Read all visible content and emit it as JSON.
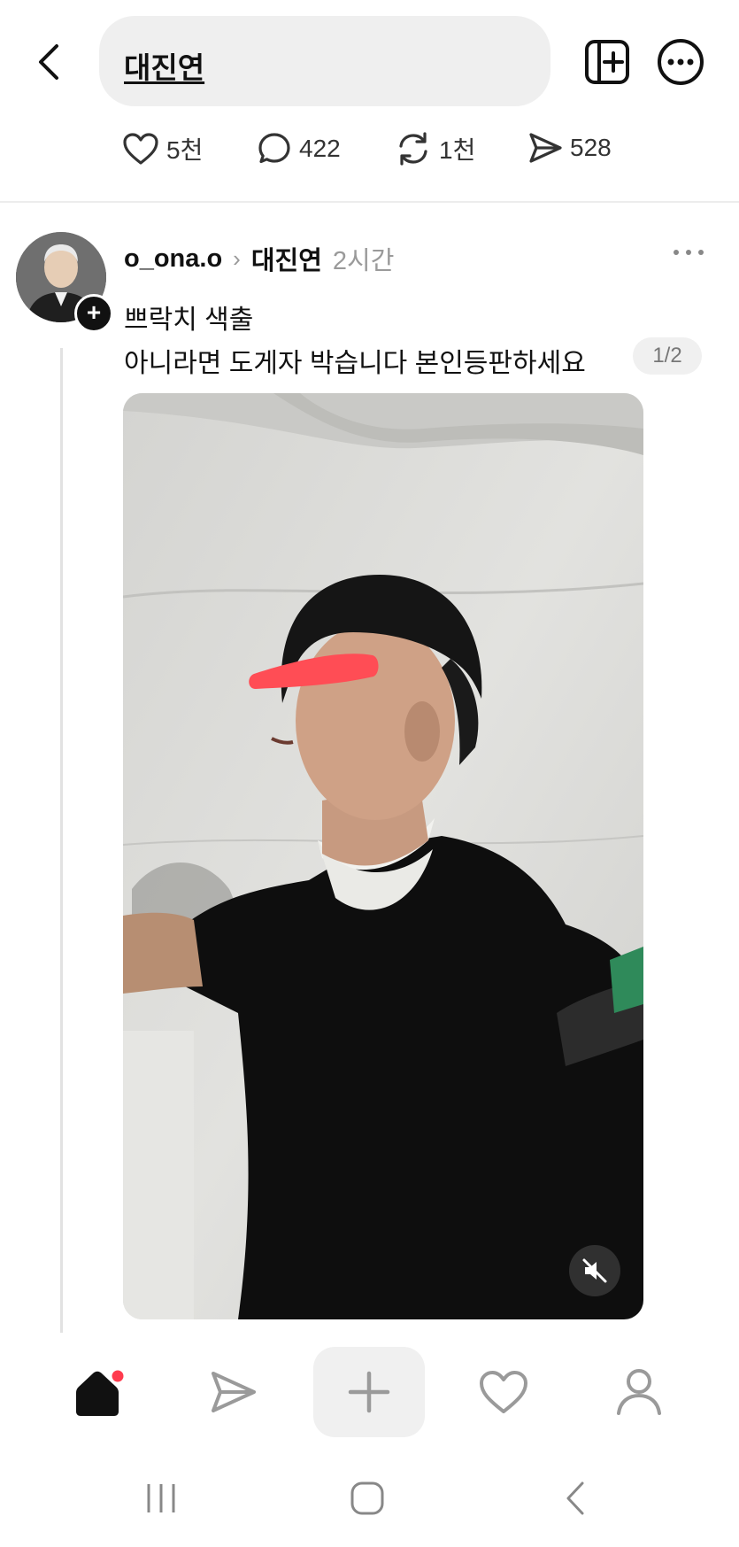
{
  "header": {
    "search_query": "대진연",
    "back_icon": "chevron-left-icon",
    "new_tab_icon": "plus-square-icon",
    "more_icon": "more-circle-icon"
  },
  "stats": {
    "likes": "5천",
    "comments": "422",
    "reposts": "1천",
    "shares": "528"
  },
  "post": {
    "username": "o_ona.o",
    "community": "대진연",
    "time": "2시간",
    "line1": "쁘락치 색출",
    "line2": "아니라면 도게자 박습니다 본인등판하세요",
    "page_indicator": "1/2",
    "media_caption": "",
    "mute_icon": "mute-icon"
  },
  "bottom_nav": {
    "items": [
      "home-icon",
      "send-icon",
      "create-icon",
      "heart-icon",
      "profile-icon"
    ],
    "home_has_notification": true
  },
  "system_nav": {
    "items": [
      "recents-icon",
      "home-icon",
      "back-icon"
    ]
  },
  "colors": {
    "accent_red": "#ff3b4e",
    "pill_bg": "#efefef",
    "muted_text": "#9a9a9a",
    "redaction": "#ff4d55"
  }
}
